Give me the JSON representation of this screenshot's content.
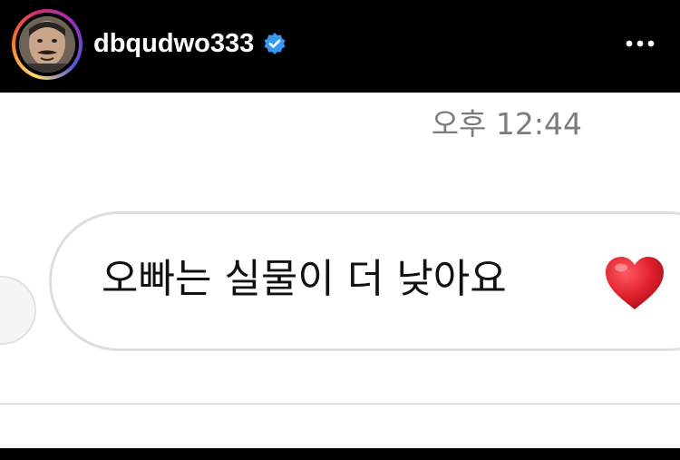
{
  "header": {
    "username": "dbqudwo333",
    "verified_badge_color": "#3897f0",
    "more_icon": "more-horizontal-icon"
  },
  "thread": {
    "timestamp": "오후 12:44",
    "message": {
      "text": "오빠는 실물이 더 낮아요",
      "emoji": "heart-emoji",
      "emoji_color": "#e0202c"
    }
  }
}
